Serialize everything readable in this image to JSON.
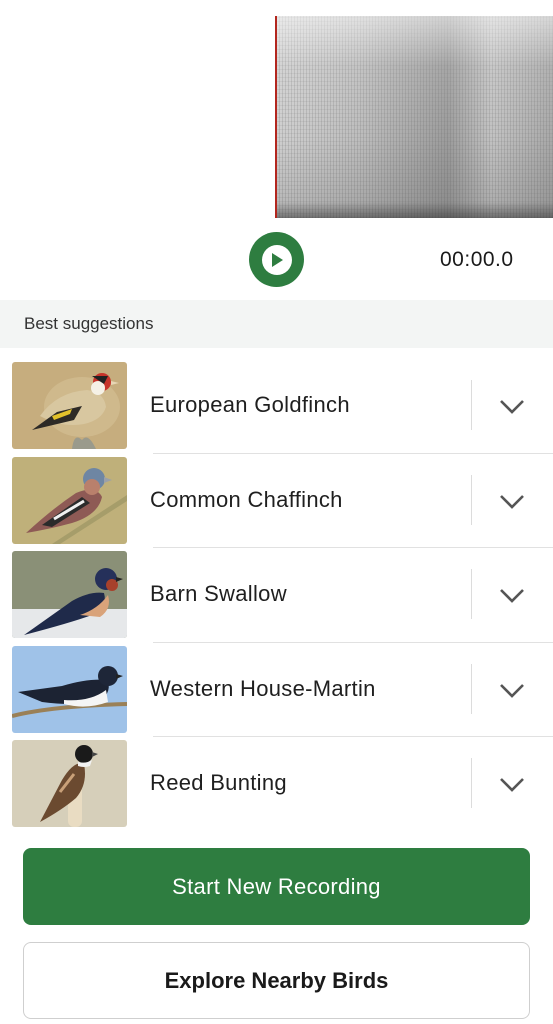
{
  "player": {
    "time": "00:00.0",
    "play_icon": "play-icon",
    "accent": "#2e7d40",
    "playhead_color": "#b3261e"
  },
  "suggestions": {
    "header": "Best suggestions",
    "items": [
      {
        "name": "European Goldfinch",
        "icon": "chevron-down-icon"
      },
      {
        "name": "Common Chaffinch",
        "icon": "chevron-down-icon"
      },
      {
        "name": "Barn Swallow",
        "icon": "chevron-down-icon"
      },
      {
        "name": "Western House-Martin",
        "icon": "chevron-down-icon"
      },
      {
        "name": "Reed Bunting",
        "icon": "chevron-down-icon"
      }
    ]
  },
  "actions": {
    "start_label": "Start New Recording",
    "explore_label": "Explore Nearby Birds"
  }
}
